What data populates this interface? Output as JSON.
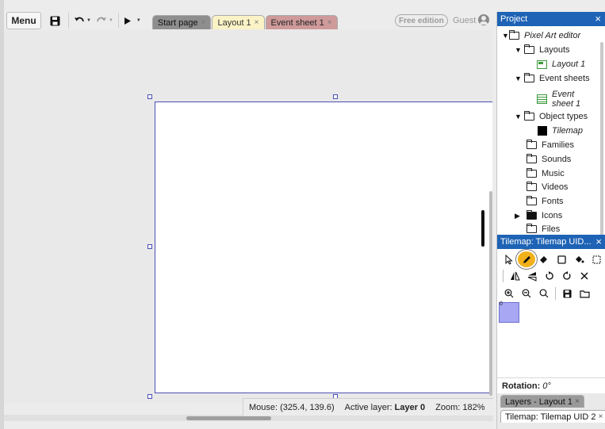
{
  "toolbar": {
    "menu_label": "Menu",
    "icons": [
      "save-icon",
      "undo-icon",
      "redo-icon",
      "play-icon"
    ],
    "tabs": [
      {
        "label": "Start page",
        "close": "×"
      },
      {
        "label": "Layout 1",
        "close": "×"
      },
      {
        "label": "Event sheet 1",
        "close": "×"
      }
    ],
    "edition_badge": "Free edition",
    "user_label": "Guest"
  },
  "status": {
    "mouse_label": "Mouse:",
    "mouse_value": "(325.4, 139.6)",
    "layer_label": "Active layer:",
    "layer_value": "Layer 0",
    "zoom_label": "Zoom:",
    "zoom_value": "182%"
  },
  "project_panel": {
    "title": "Project",
    "close": "×",
    "tree": {
      "root": "Pixel Art editor",
      "layouts_folder": "Layouts",
      "layout_item": "Layout 1",
      "event_sheets_folder": "Event sheets",
      "event_item_line1": "Event",
      "event_item_line2": "sheet 1",
      "object_types_folder": "Object types",
      "object_item": "Tilemap",
      "families": "Families",
      "sounds": "Sounds",
      "music": "Music",
      "videos": "Videos",
      "fonts": "Fonts",
      "icons": "Icons",
      "files": "Files"
    }
  },
  "tilemap_panel": {
    "title": "Tilemap: Tilemap UID...",
    "close": "×",
    "tile_index": "0",
    "swatch_color": "#a7a7f4",
    "rotation_label": "Rotation:",
    "rotation_value": "0°"
  },
  "bottom_tabs": [
    {
      "label": "Layers - Layout 1",
      "close": "×"
    },
    {
      "label": "Tilemap: Tilemap UID 2",
      "close": "×"
    }
  ],
  "colors": {
    "panel_header": "#1e63b5",
    "selection_border": "#4b4fb5",
    "active_tool": "#f1b11a"
  }
}
